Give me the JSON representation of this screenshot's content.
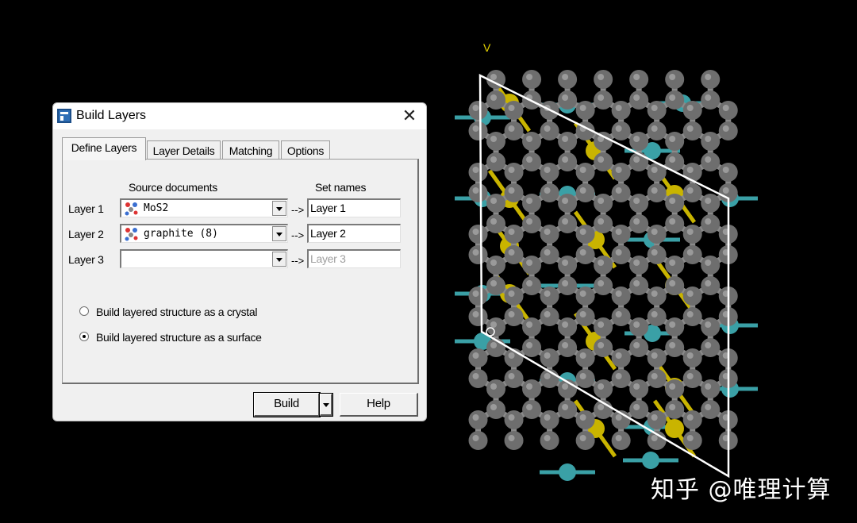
{
  "dialog": {
    "title": "Build Layers",
    "close_glyph": "✕",
    "tabs": [
      {
        "label": "Define Layers",
        "active": true
      },
      {
        "label": "Layer Details",
        "active": false
      },
      {
        "label": "Matching",
        "active": false
      },
      {
        "label": "Options",
        "active": false
      }
    ],
    "headers": {
      "source": "Source documents",
      "names": "Set names"
    },
    "arrow": "-->",
    "layers": [
      {
        "label": "Layer 1",
        "source": "MoS2",
        "has_icon": true,
        "name": "Layer 1",
        "name_enabled": true
      },
      {
        "label": "Layer 2",
        "source": "graphite (8)",
        "has_icon": true,
        "name": "Layer 2",
        "name_enabled": true
      },
      {
        "label": "Layer 3",
        "source": "",
        "has_icon": false,
        "name": "Layer 3",
        "name_enabled": false
      }
    ],
    "options": [
      {
        "label": "Build layered structure as a crystal",
        "selected": false
      },
      {
        "label": "Build layered structure as a surface",
        "selected": true
      }
    ],
    "buttons": {
      "build": "Build",
      "help": "Help"
    }
  },
  "viewer": {
    "axis_label": "V",
    "colors": {
      "carbon": "#6e6e6e",
      "sulfur": "#c9b400",
      "molybdenum": "#3aa0a6",
      "cell": "#ffffff"
    }
  },
  "watermark": "知乎 @唯理计算",
  "icons": [
    "app-icon",
    "close-icon",
    "molecule-icon",
    "dropdown-arrow-icon",
    "radio-icon"
  ]
}
